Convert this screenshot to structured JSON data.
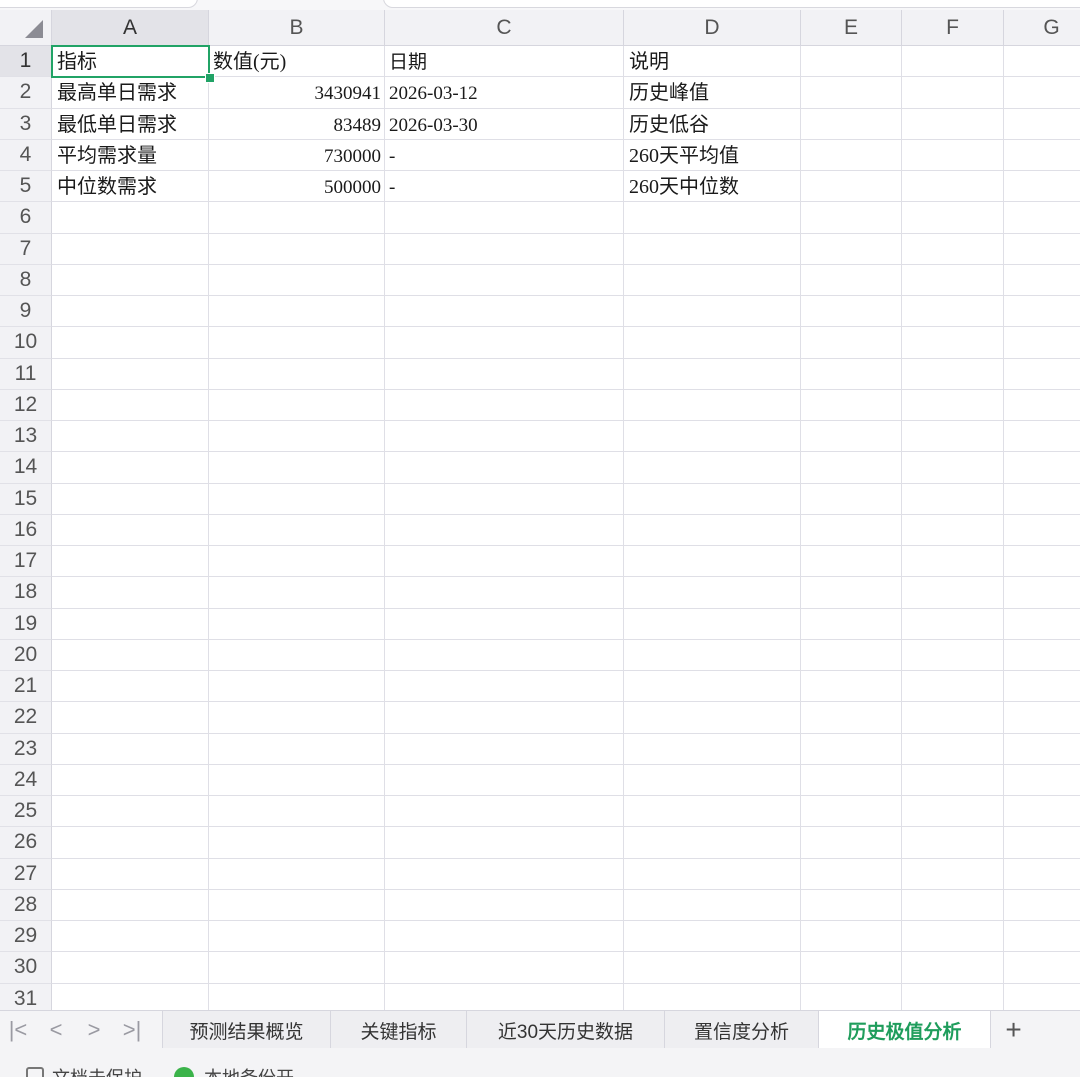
{
  "columns": [
    "A",
    "B",
    "C",
    "D",
    "E",
    "F",
    "G"
  ],
  "rows": [
    "1",
    "2",
    "3",
    "4",
    "5",
    "6",
    "7",
    "8",
    "9",
    "10",
    "11",
    "12",
    "13",
    "14",
    "15",
    "16",
    "17",
    "18",
    "19",
    "20",
    "21",
    "22",
    "23",
    "24",
    "25",
    "26",
    "27",
    "28",
    "29",
    "30",
    "31"
  ],
  "selected_cell": "A1",
  "cells": [
    [
      "指标",
      "数值(元)",
      "日期",
      "说明"
    ],
    [
      "最高单日需求",
      "3430941",
      "2026-03-12",
      "历史峰值"
    ],
    [
      "最低单日需求",
      "83489",
      "2026-03-30",
      "历史低谷"
    ],
    [
      "平均需求量",
      "730000",
      "-",
      "260天平均值"
    ],
    [
      "中位数需求",
      "500000",
      "-",
      "260天中位数"
    ]
  ],
  "tabs": [
    {
      "label": "预测结果概览",
      "active": false
    },
    {
      "label": "关键指标",
      "active": false
    },
    {
      "label": "近30天历史数据",
      "active": false
    },
    {
      "label": "置信度分析",
      "active": false
    },
    {
      "label": "历史极值分析",
      "active": true
    }
  ],
  "nav": {
    "first": "|<",
    "prev": "<",
    "next": ">",
    "last": ">|",
    "add": "+"
  },
  "status": {
    "protect": "文档未保护",
    "backup": "本地备份开"
  },
  "colors": {
    "accent": "#21a366",
    "active_tab_text": "#1f9d5c",
    "header_bg": "#f2f2f5"
  }
}
